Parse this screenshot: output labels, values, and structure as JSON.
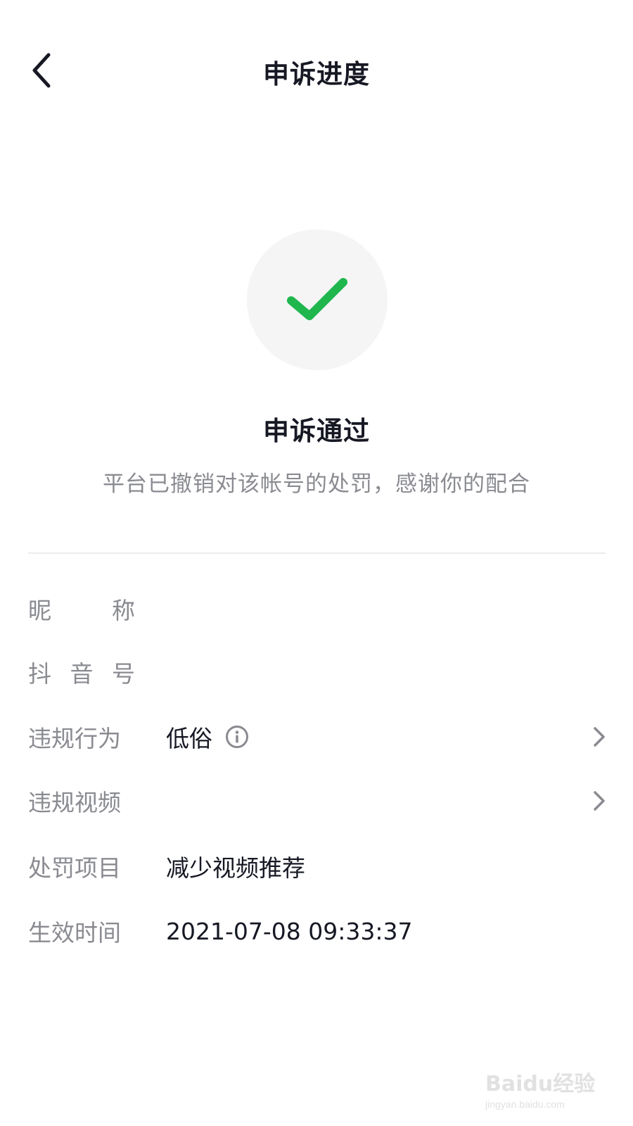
{
  "header": {
    "title": "申诉进度"
  },
  "status": {
    "title": "申诉通过",
    "description": "平台已撤销对该帐号的处罚，感谢你的配合",
    "icon": "checkmark-icon",
    "icon_color": "#1fb64e"
  },
  "info": {
    "rows": [
      {
        "label_chars": [
          "昵",
          "称"
        ],
        "label": "昵称",
        "value": ""
      },
      {
        "label_chars": [
          "抖",
          "音",
          "号"
        ],
        "label": "抖音号",
        "value": ""
      },
      {
        "label": "违规行为",
        "value": "低俗",
        "has_info_icon": true,
        "has_chevron": true
      },
      {
        "label": "违规视频",
        "value": "",
        "has_chevron": true
      },
      {
        "label": "处罚项目",
        "value": "减少视频推荐"
      },
      {
        "label": "生效时间",
        "value": "2021-07-08 09:33:37"
      }
    ]
  },
  "watermark": {
    "logo": "Baidu经验",
    "url": "jingyan.baidu.com"
  }
}
